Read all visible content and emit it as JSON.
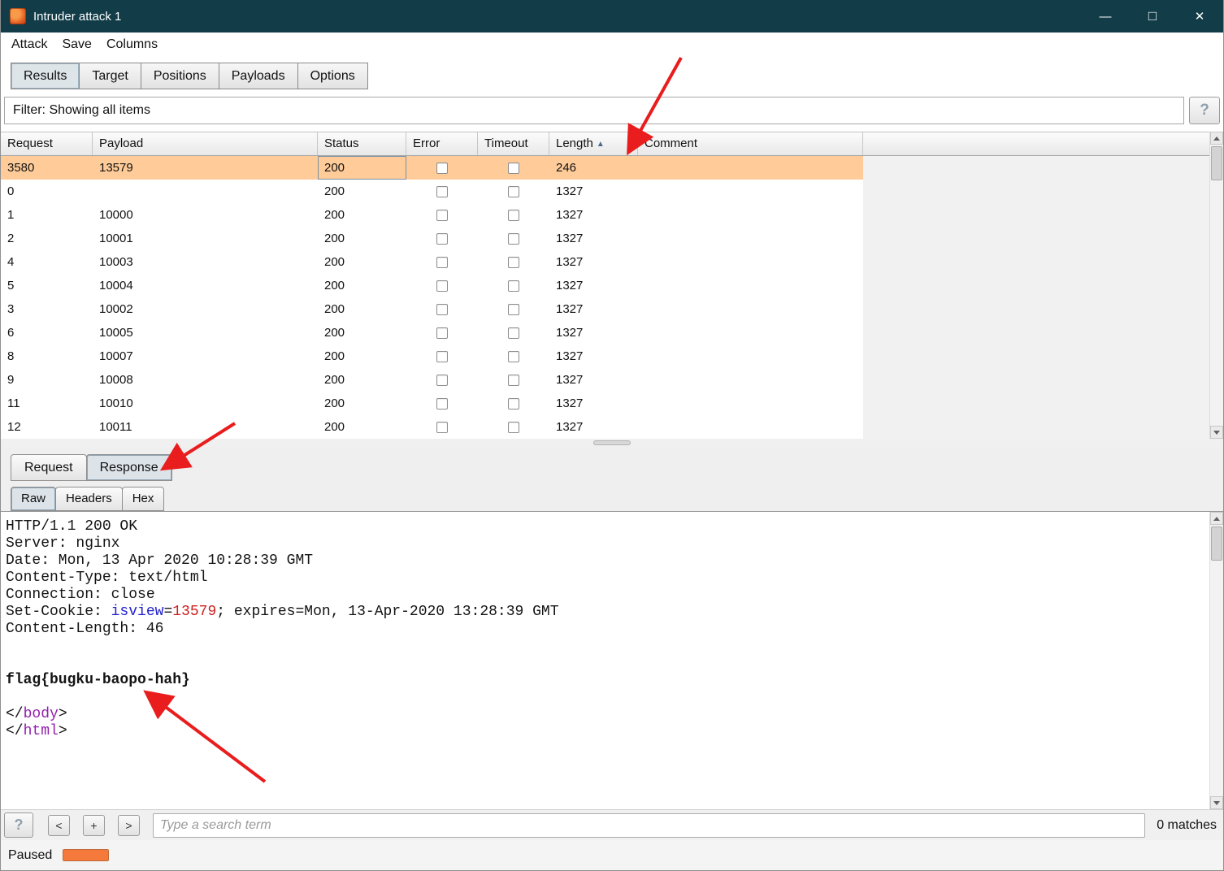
{
  "colors": {
    "titlebar": "#113c48",
    "selection": "#ffcc99",
    "arrow_red": "#e91d1d",
    "progress_orange": "#f5793b",
    "link_blue": "#2222cc",
    "value_red": "#cc2020",
    "tag_purple": "#9320ae"
  },
  "window": {
    "title": "Intruder attack 1",
    "minimize_label": "—",
    "maximize_label": "□",
    "close_label": "✕"
  },
  "menu": {
    "items": [
      "Attack",
      "Save",
      "Columns"
    ]
  },
  "main_tabs": {
    "items": [
      "Results",
      "Target",
      "Positions",
      "Payloads",
      "Options"
    ],
    "selected": "Results"
  },
  "filter": {
    "text": "Filter: Showing all items",
    "help_label": "?"
  },
  "results_table": {
    "columns": [
      "Request",
      "Payload",
      "Status",
      "Error",
      "Timeout",
      "Length",
      "Comment"
    ],
    "sort_column": "Length",
    "sort_indicator": "▲",
    "rows": [
      {
        "request": "3580",
        "payload": "13579",
        "status": "200",
        "error": false,
        "timeout": false,
        "length": "246",
        "comment": "",
        "selected": true
      },
      {
        "request": "0",
        "payload": "",
        "status": "200",
        "error": false,
        "timeout": false,
        "length": "1327",
        "comment": ""
      },
      {
        "request": "1",
        "payload": "10000",
        "status": "200",
        "error": false,
        "timeout": false,
        "length": "1327",
        "comment": ""
      },
      {
        "request": "2",
        "payload": "10001",
        "status": "200",
        "error": false,
        "timeout": false,
        "length": "1327",
        "comment": ""
      },
      {
        "request": "4",
        "payload": "10003",
        "status": "200",
        "error": false,
        "timeout": false,
        "length": "1327",
        "comment": ""
      },
      {
        "request": "5",
        "payload": "10004",
        "status": "200",
        "error": false,
        "timeout": false,
        "length": "1327",
        "comment": ""
      },
      {
        "request": "3",
        "payload": "10002",
        "status": "200",
        "error": false,
        "timeout": false,
        "length": "1327",
        "comment": ""
      },
      {
        "request": "6",
        "payload": "10005",
        "status": "200",
        "error": false,
        "timeout": false,
        "length": "1327",
        "comment": ""
      },
      {
        "request": "8",
        "payload": "10007",
        "status": "200",
        "error": false,
        "timeout": false,
        "length": "1327",
        "comment": ""
      },
      {
        "request": "9",
        "payload": "10008",
        "status": "200",
        "error": false,
        "timeout": false,
        "length": "1327",
        "comment": ""
      },
      {
        "request": "11",
        "payload": "10010",
        "status": "200",
        "error": false,
        "timeout": false,
        "length": "1327",
        "comment": ""
      },
      {
        "request": "12",
        "payload": "10011",
        "status": "200",
        "error": false,
        "timeout": false,
        "length": "1327",
        "comment": ""
      }
    ]
  },
  "message_tabs": {
    "items": [
      "Request",
      "Response"
    ],
    "selected": "Response"
  },
  "view_tabs": {
    "items": [
      "Raw",
      "Headers",
      "Hex"
    ],
    "selected": "Raw"
  },
  "response": {
    "lines": [
      [
        {
          "t": "HTTP/1.1 200 OK"
        }
      ],
      [
        {
          "t": "Server: nginx"
        }
      ],
      [
        {
          "t": "Date: Mon, 13 Apr 2020 10:28:39 GMT"
        }
      ],
      [
        {
          "t": "Content-Type: text/html"
        }
      ],
      [
        {
          "t": "Connection: close"
        }
      ],
      [
        {
          "t": "Set-Cookie: "
        },
        {
          "t": "isview",
          "s": "blue"
        },
        {
          "t": "="
        },
        {
          "t": "13579",
          "s": "red"
        },
        {
          "t": "; expires=Mon, 13-Apr-2020 13:28:39 GMT"
        }
      ],
      [
        {
          "t": "Content-Length: 46"
        }
      ],
      [],
      [],
      [
        {
          "t": "flag{bugku-baopo-hah}",
          "s": "bold"
        }
      ],
      [],
      [
        {
          "t": "</"
        },
        {
          "t": "body",
          "s": "tag"
        },
        {
          "t": ">"
        }
      ],
      [
        {
          "t": "</"
        },
        {
          "t": "html",
          "s": "tag"
        },
        {
          "t": ">"
        }
      ]
    ]
  },
  "search": {
    "help_label": "?",
    "prev_label": "<",
    "add_label": "+",
    "next_label": ">",
    "placeholder": "Type a search term",
    "matches_text": "0 matches"
  },
  "status_bar": {
    "state_label": "Paused",
    "progress_percent": 100
  }
}
